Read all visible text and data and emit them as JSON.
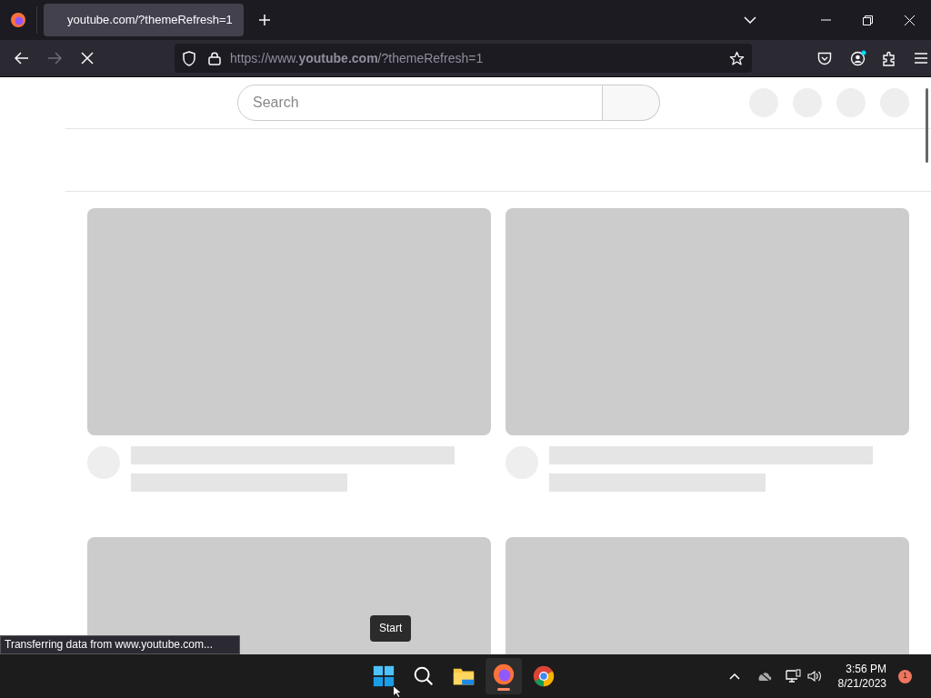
{
  "browser": {
    "tab": {
      "title": "youtube.com/?themeRefresh=1"
    },
    "nav_buttons": [
      {
        "kind": "back",
        "disabled": false
      },
      {
        "kind": "forward",
        "disabled": true
      },
      {
        "kind": "stop",
        "disabled": false
      }
    ],
    "url": "https://www.**youtube.com**/?themeRefresh=1",
    "status": "Transferring data from www.youtube.com..."
  },
  "page": {
    "search": {
      "placeholder": "Search"
    }
  },
  "taskbar": {
    "tooltip": "Start",
    "apps": [
      {
        "kind": "start",
        "running": false
      },
      {
        "kind": "search",
        "running": false
      },
      {
        "kind": "files",
        "running": false
      },
      {
        "kind": "firefox",
        "running": true
      },
      {
        "kind": "chrome",
        "running": false
      }
    ],
    "time": "3:56 PM",
    "date": "8/21/2023",
    "notifications": "1"
  }
}
